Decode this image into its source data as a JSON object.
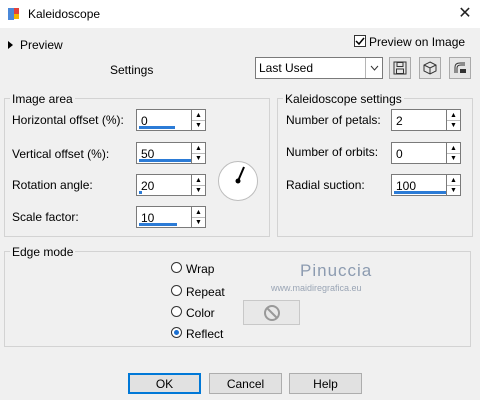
{
  "window": {
    "title": "Kaleidoscope",
    "close_label": "✕"
  },
  "preview": {
    "label": "Preview",
    "on_image_label": "Preview on Image",
    "on_image_checked": true
  },
  "settings": {
    "label": "Settings",
    "preset_value": "Last Used"
  },
  "image_area": {
    "title": "Image area",
    "fields": [
      {
        "label": "Horizontal offset (%):",
        "value": "0",
        "fill": 0.0
      },
      {
        "label": "Vertical offset (%):",
        "value": "50",
        "fill": 0.5
      },
      {
        "label": "Rotation angle:",
        "value": "20",
        "fill": 0.06
      },
      {
        "label": "Scale factor:",
        "value": "10",
        "fill": 0.5
      }
    ]
  },
  "kaleidoscope": {
    "title": "Kaleidoscope settings",
    "fields": [
      {
        "label": "Number of petals:",
        "value": "2"
      },
      {
        "label": "Number of orbits:",
        "value": "0"
      },
      {
        "label": "Radial suction:",
        "value": "100",
        "fill": 1.0
      }
    ]
  },
  "edge_mode": {
    "title": "Edge mode",
    "options": [
      {
        "label": "Wrap",
        "selected": false
      },
      {
        "label": "Repeat",
        "selected": false
      },
      {
        "label": "Color",
        "selected": false
      },
      {
        "label": "Reflect",
        "selected": true
      }
    ]
  },
  "watermark": {
    "name": "Pinuccia",
    "url": "www.maidiregrafica.eu"
  },
  "buttons": {
    "ok": "OK",
    "cancel": "Cancel",
    "help": "Help"
  },
  "colors": {
    "accent": "#0078d7",
    "spin_fill": "#2b7bd6",
    "background": "#f0f0f0"
  }
}
